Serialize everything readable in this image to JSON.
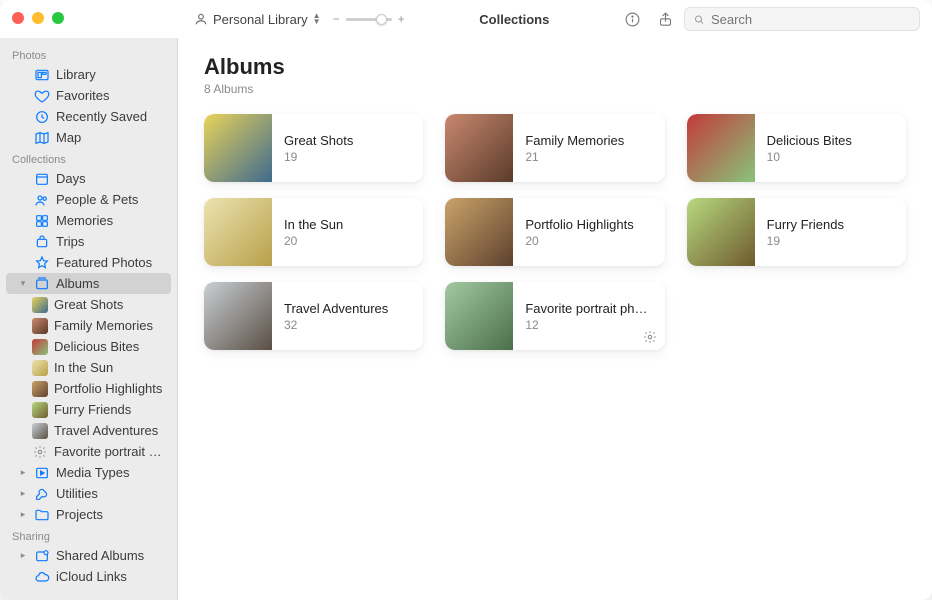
{
  "toolbar": {
    "library_label": "Personal Library",
    "zoom_minus": "−",
    "zoom_plus": "+",
    "center_title": "Collections",
    "search_placeholder": "Search"
  },
  "sidebar": {
    "sections": {
      "photos": "Photos",
      "collections": "Collections",
      "sharing": "Sharing"
    },
    "photos_items": [
      {
        "label": "Library"
      },
      {
        "label": "Favorites"
      },
      {
        "label": "Recently Saved"
      },
      {
        "label": "Map"
      }
    ],
    "collections_items": [
      {
        "label": "Days"
      },
      {
        "label": "People & Pets"
      },
      {
        "label": "Memories"
      },
      {
        "label": "Trips"
      },
      {
        "label": "Featured Photos"
      },
      {
        "label": "Albums"
      },
      {
        "label": "Media Types"
      },
      {
        "label": "Utilities"
      },
      {
        "label": "Projects"
      }
    ],
    "album_children": [
      {
        "label": "Great Shots"
      },
      {
        "label": "Family Memories"
      },
      {
        "label": "Delicious Bites"
      },
      {
        "label": "In the Sun"
      },
      {
        "label": "Portfolio Highlights"
      },
      {
        "label": "Furry Friends"
      },
      {
        "label": "Travel Adventures"
      },
      {
        "label": "Favorite portrait photos"
      }
    ],
    "sharing_items": [
      {
        "label": "Shared Albums"
      },
      {
        "label": "iCloud Links"
      }
    ]
  },
  "page": {
    "title": "Albums",
    "subtitle": "8 Albums"
  },
  "albums": [
    {
      "title": "Great Shots",
      "count": "19"
    },
    {
      "title": "Family Memories",
      "count": "21"
    },
    {
      "title": "Delicious Bites",
      "count": "10"
    },
    {
      "title": "In the Sun",
      "count": "20"
    },
    {
      "title": "Portfolio Highlights",
      "count": "20"
    },
    {
      "title": "Furry Friends",
      "count": "19"
    },
    {
      "title": "Travel Adventures",
      "count": "32"
    },
    {
      "title": "Favorite portrait photos",
      "count": "12"
    }
  ]
}
